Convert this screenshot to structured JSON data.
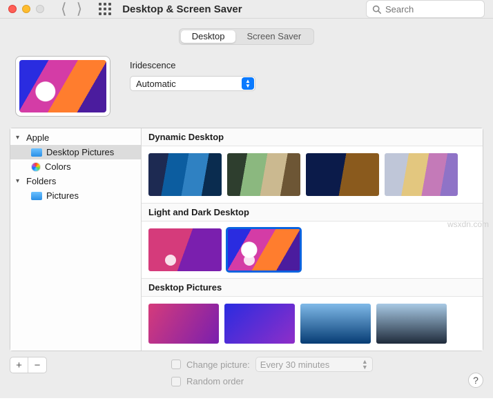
{
  "toolbar": {
    "title": "Desktop & Screen Saver",
    "search_placeholder": "Search"
  },
  "tabs": {
    "desktop": "Desktop",
    "screensaver": "Screen Saver"
  },
  "wallpaper": {
    "name": "Iridescence",
    "mode_selected": "Automatic"
  },
  "sidebar": {
    "group_apple": "Apple",
    "item_desktop_pictures": "Desktop Pictures",
    "item_colors": "Colors",
    "group_folders": "Folders",
    "item_pictures": "Pictures"
  },
  "gallery": {
    "section_dynamic": "Dynamic Desktop",
    "section_lightdark": "Light and Dark Desktop",
    "section_desktop_pictures": "Desktop Pictures"
  },
  "footer": {
    "change_picture_label": "Change picture:",
    "change_interval": "Every 30 minutes",
    "random_order_label": "Random order",
    "add_label": "+",
    "remove_label": "−",
    "help_label": "?"
  },
  "watermark": "wsxdn.com"
}
